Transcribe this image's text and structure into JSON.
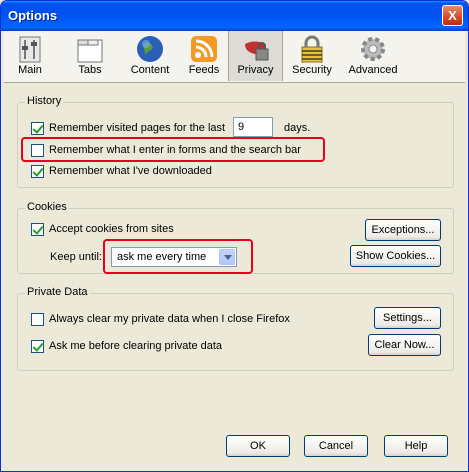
{
  "window": {
    "title": "Options",
    "close_glyph": "X"
  },
  "toolbar": {
    "panes": [
      {
        "label": "Main",
        "icon": "main-icon"
      },
      {
        "label": "Tabs",
        "icon": "tabs-icon"
      },
      {
        "label": "Content",
        "icon": "globe-icon"
      },
      {
        "label": "Feeds",
        "icon": "rss-icon"
      },
      {
        "label": "Privacy",
        "icon": "lock-mask-icon",
        "selected": true
      },
      {
        "label": "Security",
        "icon": "padlock-icon"
      },
      {
        "label": "Advanced",
        "icon": "gear-icon"
      }
    ]
  },
  "history": {
    "title": "History",
    "remember_pages_label": "Remember visited pages for the last",
    "remember_pages_checked": true,
    "days_value": "9",
    "days_unit": "days.",
    "remember_forms_label": "Remember what I enter in forms and the search bar",
    "remember_forms_checked": false,
    "remember_downloads_label": "Remember what I've downloaded",
    "remember_downloads_checked": true
  },
  "cookies": {
    "title": "Cookies",
    "accept_label": "Accept cookies from sites",
    "accept_checked": true,
    "exceptions_button": "Exceptions...",
    "keep_until_label": "Keep until:",
    "keep_until_value": "ask me every time",
    "show_cookies_button": "Show Cookies..."
  },
  "private_data": {
    "title": "Private Data",
    "always_clear_label": "Always clear my private data when I close Firefox",
    "always_clear_checked": false,
    "settings_button": "Settings...",
    "ask_before_label": "Ask me before clearing private data",
    "ask_before_checked": true,
    "clear_now_button": "Clear Now..."
  },
  "footer": {
    "ok": "OK",
    "cancel": "Cancel",
    "help": "Help"
  },
  "colors": {
    "highlight": "#e8001c",
    "titlebar": "#0053ee"
  }
}
